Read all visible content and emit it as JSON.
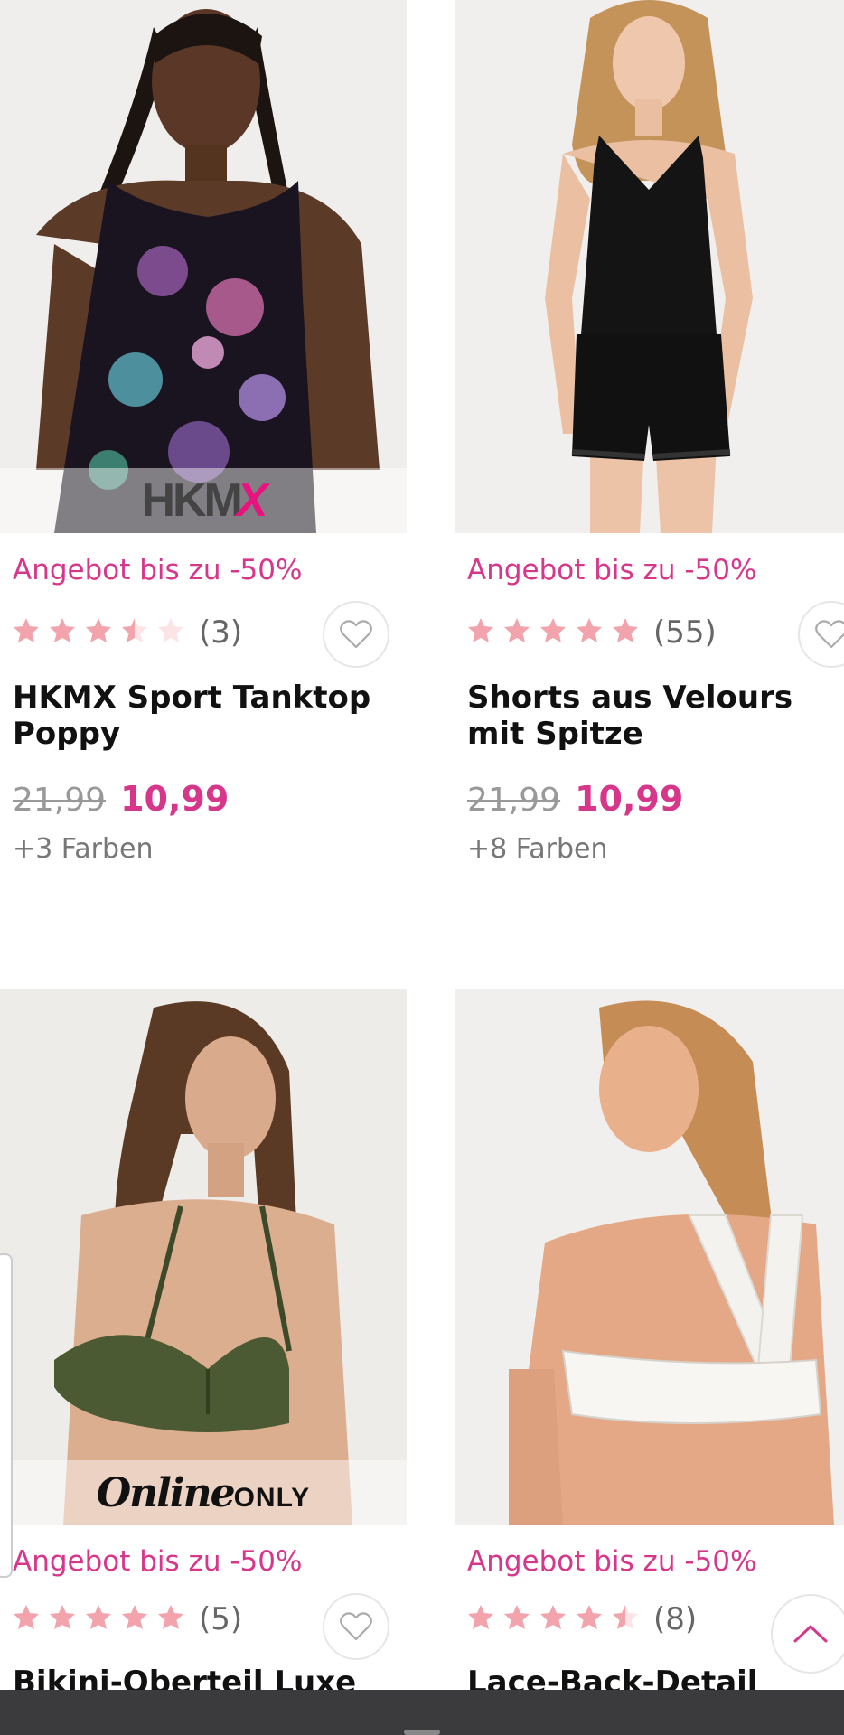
{
  "products": [
    {
      "promo": "Angebot bis zu -50%",
      "rating_count": "(3)",
      "rating_stars": 3.5,
      "name": "HKMX Sport Tanktop Poppy",
      "old_price": "21,99",
      "new_price": "10,99",
      "colors": "+3 Farben",
      "badge": "HKMX"
    },
    {
      "promo": "Angebot bis zu -50%",
      "rating_count": "(55)",
      "rating_stars": 5,
      "name": "Shorts aus Velours mit Spitze",
      "old_price": "21,99",
      "new_price": "10,99",
      "colors": "+8 Farben"
    },
    {
      "promo": "Angebot bis zu -50%",
      "rating_count": "(5)",
      "rating_stars": 5,
      "name": "Bikini-Oberteil Luxe",
      "badge_script": "Online",
      "badge_caps": "ONLY"
    },
    {
      "promo": "Angebot bis zu -50%",
      "rating_count": "(8)",
      "rating_stars": 4.5,
      "name": "Lace-Back-Detail"
    }
  ],
  "colors": {
    "accent_pink": "#d6378a",
    "star_pink": "#f2a3ac",
    "star_empty": "#fbe3e6",
    "bottom_bar": "#3b3b3d"
  },
  "icons": {
    "wishlist": "heart-outline-icon",
    "scroll_top": "chevron-up-icon",
    "rating": "star-icon"
  }
}
